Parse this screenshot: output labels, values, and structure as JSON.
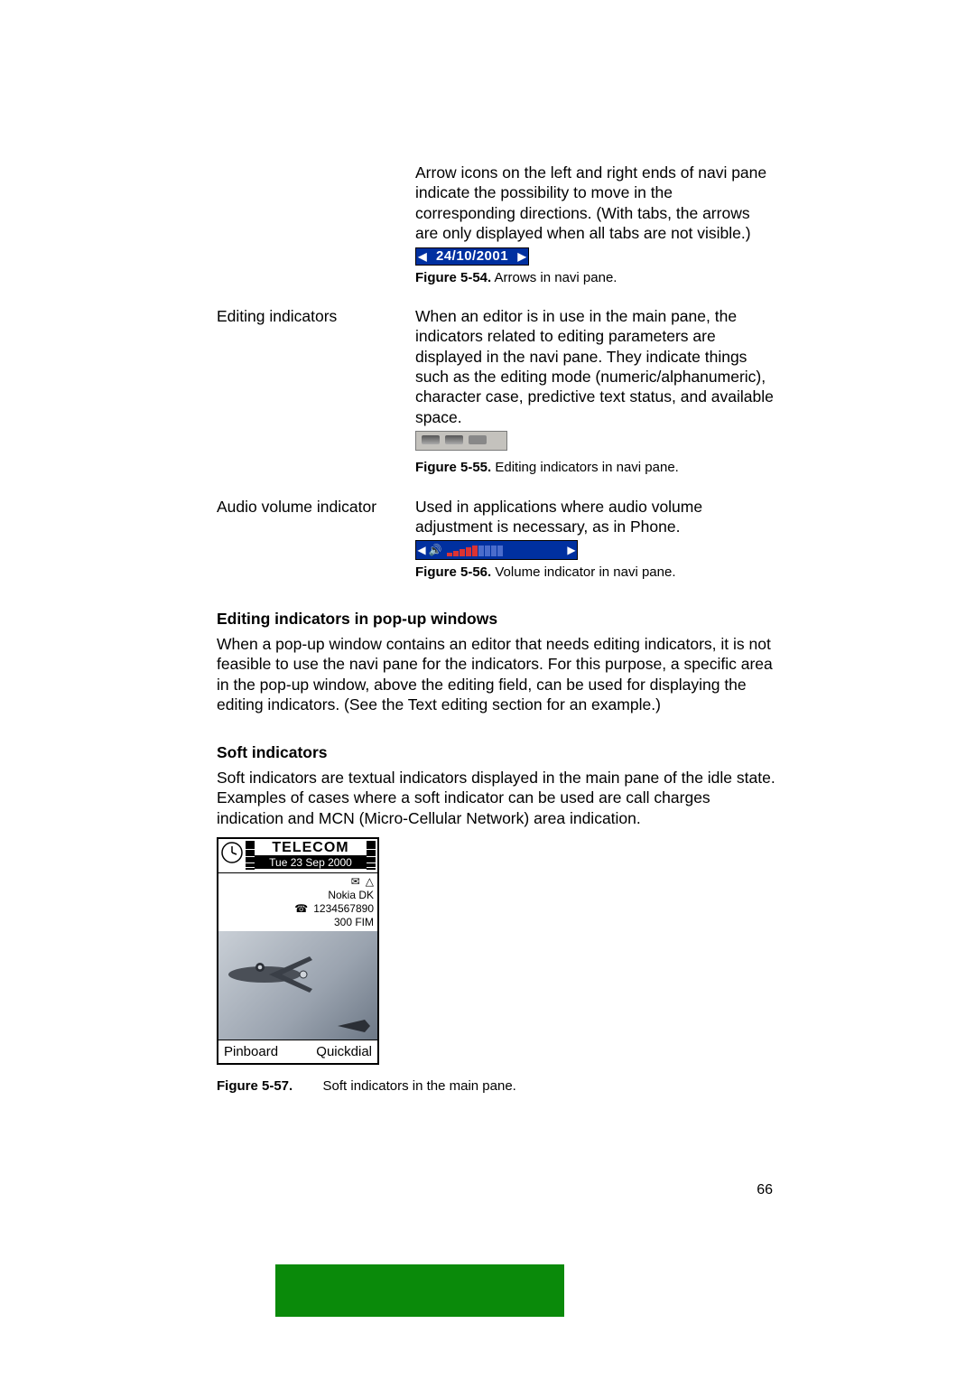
{
  "rows": {
    "arrows": {
      "desc": "Arrow icons on the left and right ends of navi pane indicate the possibility to move in the corresponding directions. (With tabs, the arrows are only displayed when all tabs are not visible.)",
      "navi_date": "24/10/2001",
      "fig_label": "Figure 5-54.",
      "fig_text": "Arrows in navi pane."
    },
    "editing": {
      "label": "Editing indicators",
      "desc": "When an editor is in use in the main pane, the indicators related to editing parameters are displayed in the navi pane. They indicate things such as the editing mode (numeric/alphanumeric), character case, predictive text status, and available space.",
      "fig_label": "Figure 5-55.",
      "fig_text": "Editing indicators in navi pane."
    },
    "audio": {
      "label": "Audio volume indicator",
      "desc": "Used in applications where audio volume adjustment is necessary, as in Phone.",
      "fig_label": "Figure 5-56.",
      "fig_text": "Volume indicator in navi pane."
    }
  },
  "sections": {
    "popup": {
      "heading": "Editing indicators in pop-up windows",
      "body": "When a pop-up window contains an editor that needs editing indicators, it is not feasible to use the navi pane for the indicators. For this purpose, a specific area in the pop-up window, above the editing field, can be used for displaying the editing indicators. (See the Text editing section for an example.)"
    },
    "soft": {
      "heading": "Soft indicators",
      "body": "Soft indicators are textual indicators displayed in the main pane of the idle state. Examples of cases where a soft indicator can be used are call charges indication and MCN (Micro-Cellular Network) area indication."
    }
  },
  "phone": {
    "operator": "TELECOM",
    "datetime": "Tue 23 Sep 2000",
    "line1": "Nokia DK",
    "line2": "1234567890",
    "line3": "300 FIM",
    "softkey_left": "Pinboard",
    "softkey_right": "Quickdial"
  },
  "fig57": {
    "label": "Figure 5-57.",
    "text": "Soft indicators in the main pane."
  },
  "page_number": "66"
}
